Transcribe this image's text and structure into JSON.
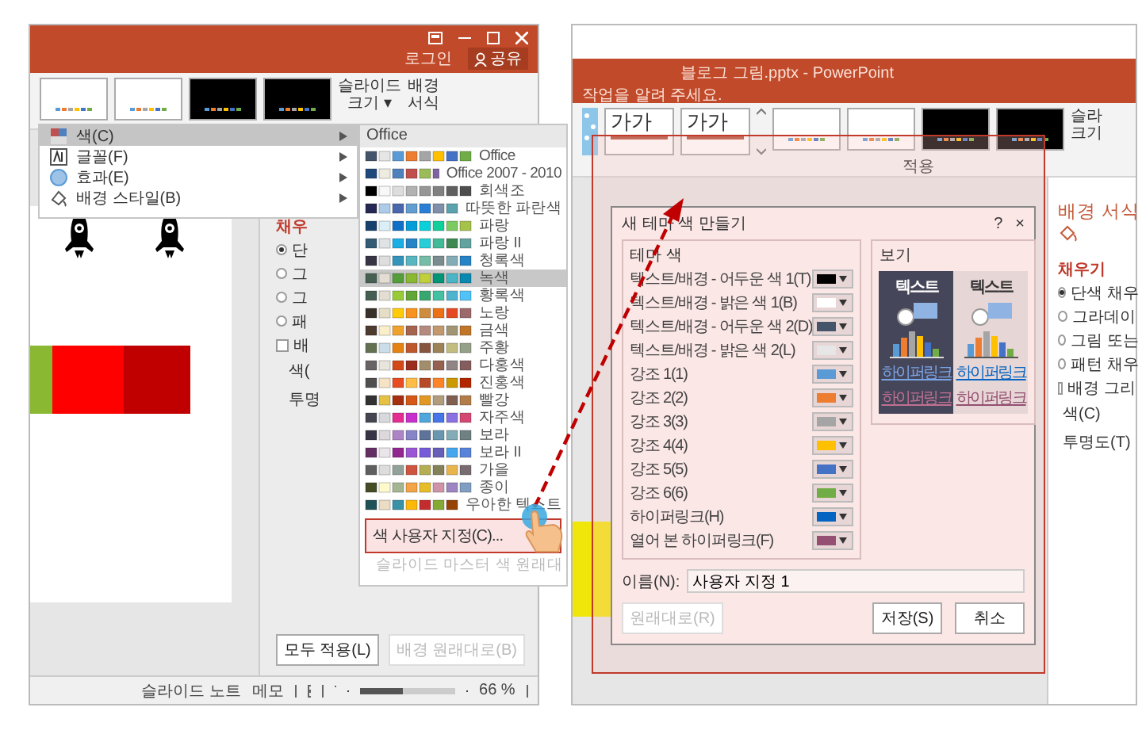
{
  "left_window": {
    "sign_in": "로그인",
    "share": "공유",
    "themes": [
      {
        "kind": "light"
      },
      {
        "kind": "light"
      },
      {
        "kind": "dark"
      },
      {
        "kind": "dark"
      }
    ],
    "ribbon_buttons": [
      {
        "lines": [
          "슬라이드",
          "크기 ▾"
        ]
      },
      {
        "lines": [
          "배경",
          "서식"
        ]
      }
    ],
    "menu": [
      {
        "label": "색(C)",
        "selected": true
      },
      {
        "label": "글꼴(F)",
        "selected": false
      },
      {
        "label": "효과(E)",
        "selected": false
      },
      {
        "label": "배경 스타일(B)",
        "selected": false
      }
    ],
    "palette_menu": {
      "header": "Office",
      "items": [
        {
          "name": "Office",
          "selected": false
        },
        {
          "name": "Office 2007 - 2010",
          "selected": false
        },
        {
          "name": "회색조",
          "selected": false
        },
        {
          "name": "따뜻한 파란색",
          "selected": false
        },
        {
          "name": "파랑",
          "selected": false
        },
        {
          "name": "파랑 II",
          "selected": false
        },
        {
          "name": "청록색",
          "selected": false
        },
        {
          "name": "녹색",
          "selected": true
        },
        {
          "name": "황록색",
          "selected": false
        },
        {
          "name": "노랑",
          "selected": false
        },
        {
          "name": "금색",
          "selected": false
        },
        {
          "name": "주황",
          "selected": false
        },
        {
          "name": "다홍색",
          "selected": false
        },
        {
          "name": "진홍색",
          "selected": false
        },
        {
          "name": "빨강",
          "selected": false
        },
        {
          "name": "자주색",
          "selected": false
        },
        {
          "name": "보라",
          "selected": false
        },
        {
          "name": "보라 II",
          "selected": false
        },
        {
          "name": "가을",
          "selected": false
        },
        {
          "name": "종이",
          "selected": false
        },
        {
          "name": "우아한 텍스트",
          "selected": false
        }
      ],
      "customize": "색 사용자 지정(C)...",
      "reset": "슬라이드 마스터 색 원래대"
    },
    "pane": {
      "heading": "채우",
      "options": [
        {
          "label": "단",
          "checked": true
        },
        {
          "label": "그",
          "checked": false
        },
        {
          "label": "그",
          "checked": false
        },
        {
          "label": "패",
          "checked": false
        }
      ],
      "checkbox": {
        "label": "배",
        "checked": false
      },
      "fields": [
        "색(",
        "투명"
      ],
      "buttons": [
        {
          "label": "모두 적용(L)",
          "disabled": false
        },
        {
          "label": "배경 원래대로(B)",
          "disabled": true
        }
      ]
    },
    "status_bar": {
      "notes": "슬라이드 노트",
      "comments": "메모",
      "zoom": "66 %",
      "zoom_slider": {
        "level": 0.45
      }
    }
  },
  "right_window": {
    "title": "블로그 그림.pptx - PowerPoint",
    "tell_me": "작업을 알려 주세요.",
    "variants": [
      {
        "label": "가가"
      },
      {
        "label": "가가"
      }
    ],
    "themes": [
      {
        "kind": "light"
      },
      {
        "kind": "light"
      },
      {
        "kind": "dark"
      },
      {
        "kind": "dark"
      }
    ],
    "group_label": "적용",
    "side_button": [
      "슬라",
      "크기"
    ],
    "dialog": {
      "title": "새 테마 색 만들기",
      "help": "?",
      "close": "×",
      "group_title": "테마 색",
      "preview_title": "보기",
      "rows": [
        {
          "label": "텍스트/배경 - 어두운 색 1(T)",
          "color": "#000000"
        },
        {
          "label": "텍스트/배경 - 밝은 색 1(B)",
          "color": "#ffffff"
        },
        {
          "label": "텍스트/배경 - 어두운 색 2(D)",
          "color": "#44546a"
        },
        {
          "label": "텍스트/배경 - 밝은 색 2(L)",
          "color": "#e7e6e6"
        },
        {
          "label": "강조 1(1)",
          "color": "#5b9bd5"
        },
        {
          "label": "강조 2(2)",
          "color": "#ed7d31"
        },
        {
          "label": "강조 3(3)",
          "color": "#a5a5a5"
        },
        {
          "label": "강조 4(4)",
          "color": "#ffc000"
        },
        {
          "label": "강조 5(5)",
          "color": "#4472c4"
        },
        {
          "label": "강조 6(6)",
          "color": "#70ad47"
        },
        {
          "label": "하이퍼링크(H)",
          "color": "#0563c1"
        },
        {
          "label": "열어 본 하이퍼링크(F)",
          "color": "#954f72"
        }
      ],
      "previews": [
        {
          "kind": "dark",
          "heading": "텍스트",
          "links": [
            "하이퍼링크",
            "하이퍼링크"
          ]
        },
        {
          "kind": "light",
          "heading": "텍스트",
          "links": [
            "하이퍼링크",
            "하이퍼링크"
          ]
        }
      ],
      "name_label": "이름(N):",
      "name_value": "사용자 지정 1",
      "buttons": [
        {
          "label": "원래대로(R)",
          "disabled": true
        },
        {
          "label": "저장(S)",
          "disabled": false
        },
        {
          "label": "취소",
          "disabled": false
        }
      ]
    },
    "pane": {
      "title": "배경 서식",
      "heading": "채우기",
      "options": [
        {
          "label": "단색 채우",
          "checked": true
        },
        {
          "label": "그라데이",
          "checked": false
        },
        {
          "label": "그림 또는",
          "checked": false
        },
        {
          "label": "패턴 채우",
          "checked": false
        }
      ],
      "checkbox": {
        "label": "배경 그리",
        "checked": false
      },
      "fields": [
        "색(C)",
        "투명도(T)"
      ]
    }
  }
}
